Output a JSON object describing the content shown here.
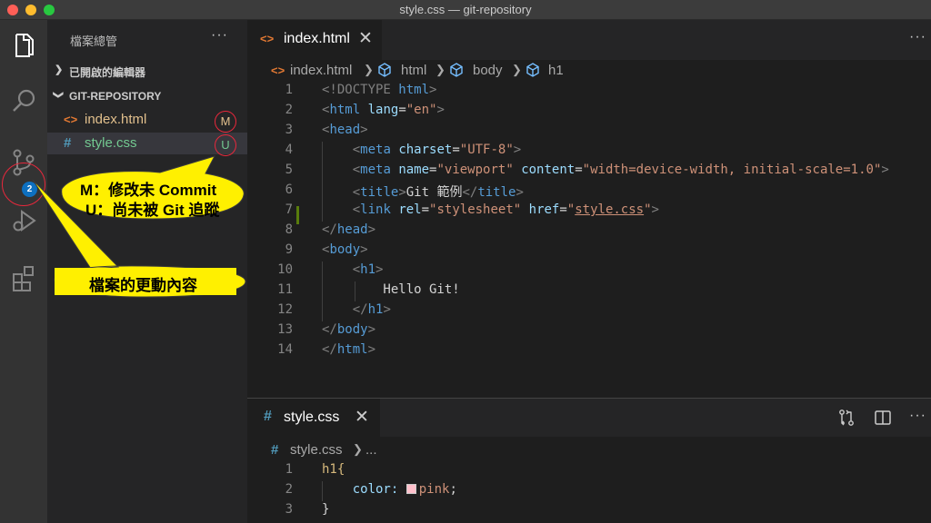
{
  "window": {
    "title": "style.css — git-repository"
  },
  "activity": {
    "scm_badge": "2"
  },
  "sidebar": {
    "title": "檔案總管",
    "more": "···",
    "open_editors": "已開啟的編輯器",
    "repo": "GIT-REPOSITORY",
    "files": [
      {
        "icon": "<>",
        "name": "index.html",
        "status": "M",
        "color": "#e2c08d",
        "status_color": "#e2c08d"
      },
      {
        "icon": "#",
        "name": "style.css",
        "status": "U",
        "color": "#73c991",
        "status_color": "#73c991"
      }
    ]
  },
  "editor1": {
    "tab": {
      "icon": "<>",
      "label": "index.html",
      "close": "✕"
    },
    "more": "···",
    "breadcrumb": [
      "index.html",
      "html",
      "body",
      "h1"
    ]
  },
  "code1": {
    "line_numbers": [
      "1",
      "2",
      "3",
      "4",
      "5",
      "6",
      "7",
      "8",
      "9",
      "10",
      "11",
      "12",
      "13",
      "14"
    ],
    "lines": [
      [
        "<!DOCTYPE ",
        "html",
        ">"
      ],
      [
        "<",
        "html",
        " ",
        "lang",
        "=",
        "\"en\"",
        ">"
      ],
      [
        "<",
        "head",
        ">"
      ],
      [
        "    <",
        "meta",
        " ",
        "charset",
        "=",
        "\"UTF-8\"",
        ">"
      ],
      [
        "    <",
        "meta",
        " ",
        "name",
        "=",
        "\"viewport\"",
        " ",
        "content",
        "=",
        "\"width=device-width, initial-scale=1.0\"",
        ">"
      ],
      [
        "    <",
        "title",
        ">",
        "Git 範例",
        "</",
        "title",
        ">"
      ],
      [
        "    <",
        "link",
        " ",
        "rel",
        "=",
        "\"stylesheet\"",
        " ",
        "href",
        "=",
        "\"",
        "style.css",
        "\"",
        ">"
      ],
      [
        "</",
        "head",
        ">"
      ],
      [
        "<",
        "body",
        ">"
      ],
      [
        "    <",
        "h1",
        ">"
      ],
      [
        "        Hello Git!"
      ],
      [
        "    </",
        "h1",
        ">"
      ],
      [
        "</",
        "body",
        ">"
      ],
      [
        "</",
        "html",
        ">"
      ]
    ]
  },
  "editor2": {
    "tab": {
      "icon": "#",
      "label": "style.css",
      "close": "✕"
    },
    "more": "···",
    "breadcrumb": [
      "style.css",
      "..."
    ],
    "line_numbers": [
      "1",
      "2",
      "3"
    ],
    "lines": [
      "h1{",
      "    color: ",
      "pink",
      ";",
      "}"
    ]
  },
  "annotations": {
    "status_legend_line1": "M：修改未 Commit",
    "status_legend_line2": "U：尚未被 Git 追蹤",
    "changes_label": "檔案的更動內容"
  }
}
